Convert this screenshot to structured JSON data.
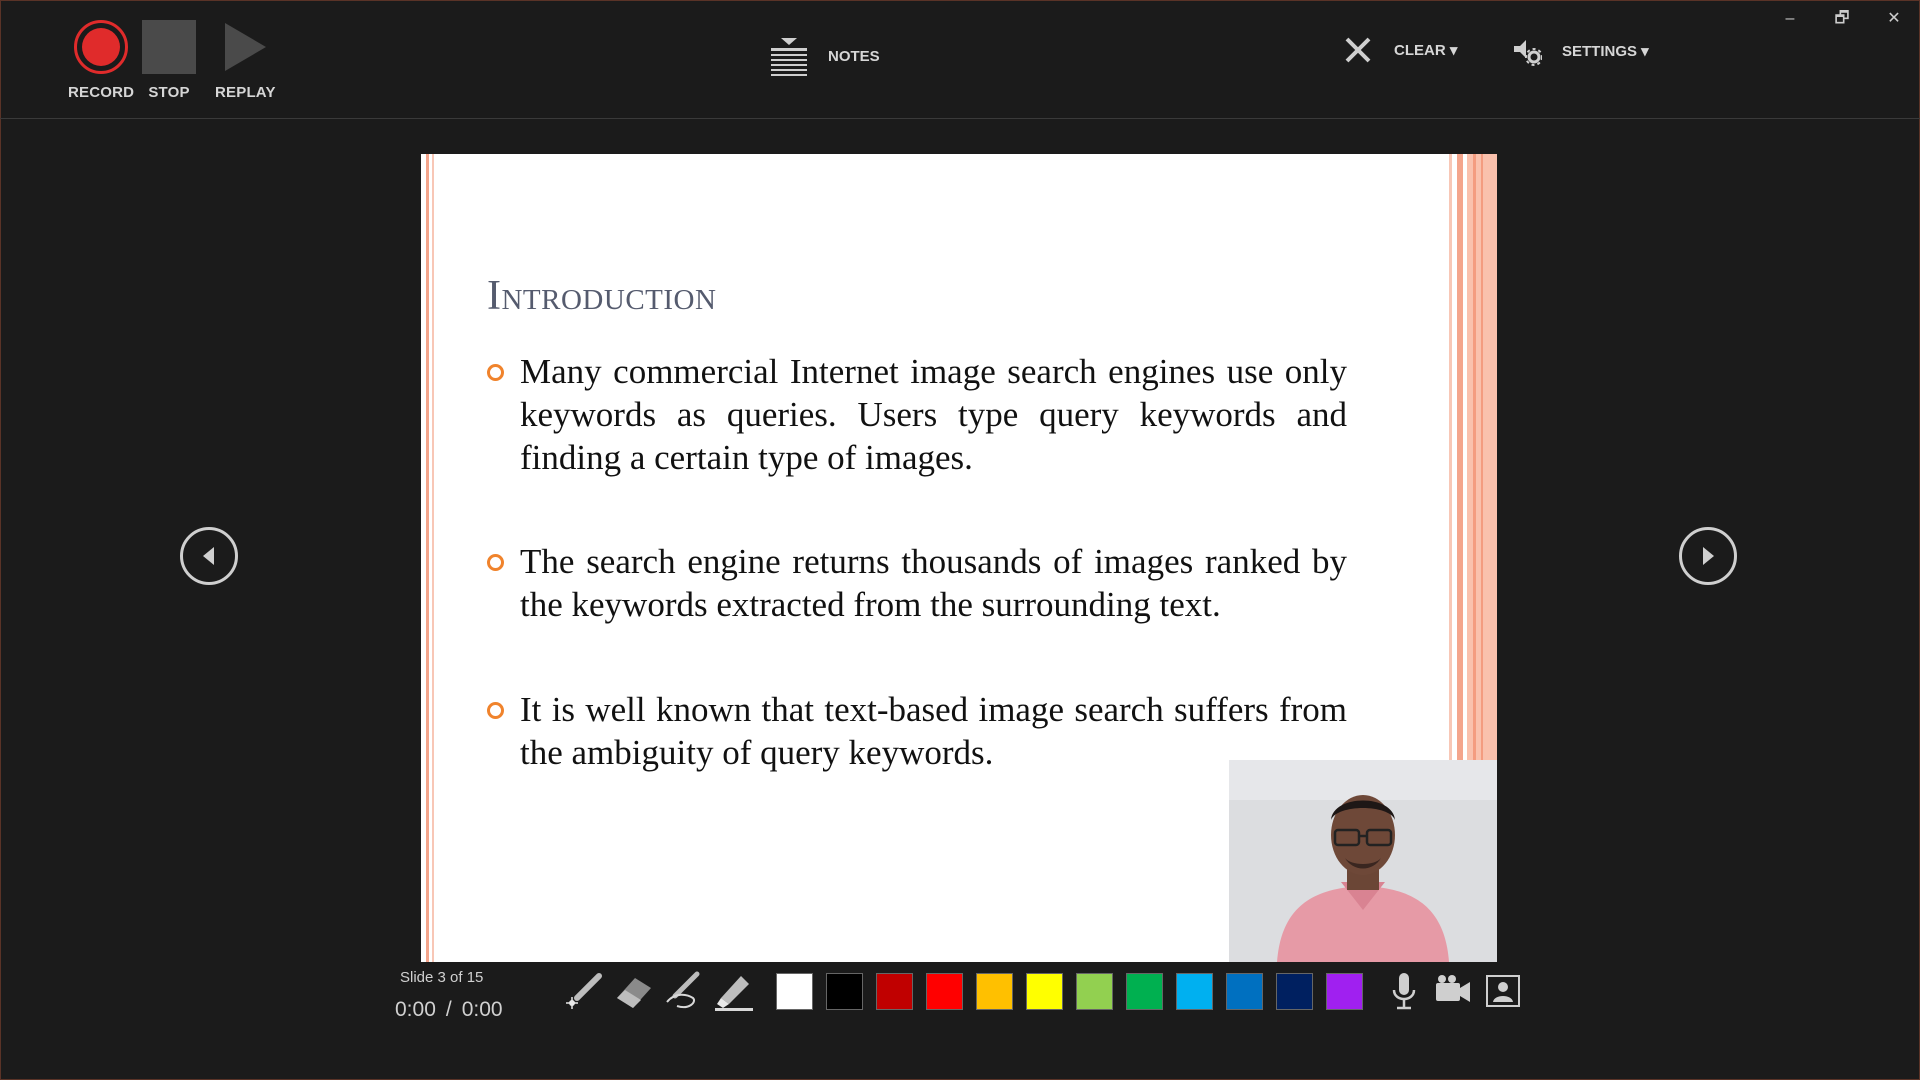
{
  "toolbar": {
    "record_label": "RECORD",
    "stop_label": "STOP",
    "replay_label": "REPLAY",
    "notes_label": "NOTES",
    "clear_label": "CLEAR ▾",
    "settings_label": "SETTINGS ▾",
    "record_color": "#e02b2b"
  },
  "window_controls": {
    "minimize": "–",
    "restore": "🗗",
    "close": "✕"
  },
  "slide": {
    "title": "Introduction",
    "bullets": [
      "Many commercial Internet image search engines use only keywords as queries. Users type query keywords and finding a certain type of images.",
      "The search engine returns thousands of images ranked by the keywords extracted from the surrounding text.",
      "It is well known that text-based image search suffers from the ambiguity of query keywords."
    ],
    "bullet_color": "#f0832c",
    "accent_color": "#f4a58c"
  },
  "status": {
    "slide_counter": "Slide 3 of 15",
    "elapsed": "0:00",
    "separator": "/",
    "total": "0:00"
  },
  "pen_tools": [
    "laser-pointer",
    "eraser",
    "pen",
    "highlighter"
  ],
  "colors": [
    "#ffffff",
    "#000000",
    "#c00000",
    "#ff0000",
    "#ffc000",
    "#ffff00",
    "#92d050",
    "#00b050",
    "#00b0f0",
    "#0070c0",
    "#002060",
    "#a020f0"
  ],
  "media_controls": [
    "microphone",
    "camera",
    "camera-preview"
  ]
}
